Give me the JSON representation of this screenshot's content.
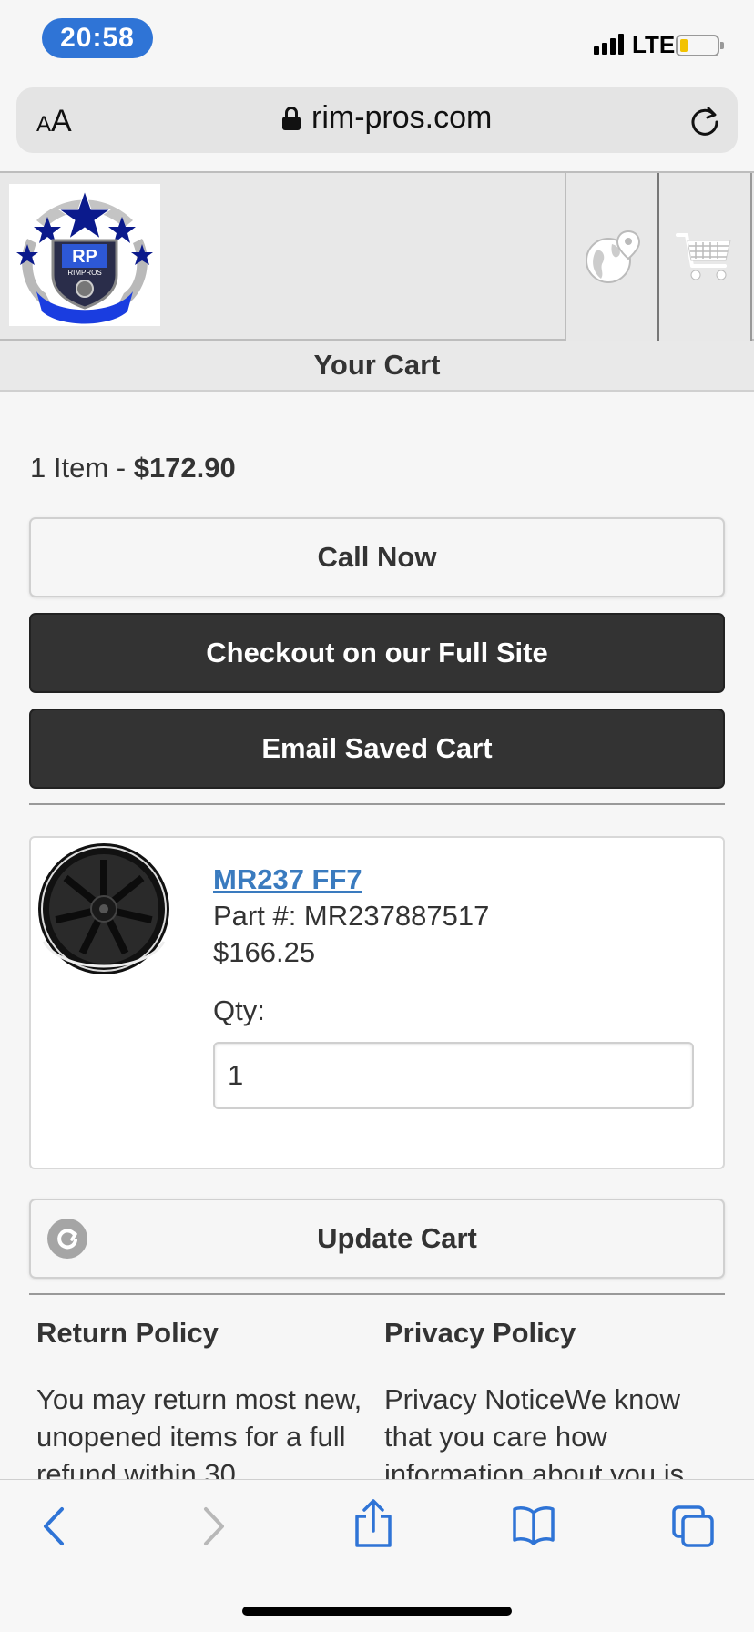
{
  "status_bar": {
    "time": "20:58",
    "network": "LTE"
  },
  "browser": {
    "text_size_label": "AA",
    "url": "rim-pros.com"
  },
  "header": {
    "logo_text": "RP",
    "logo_subtext": "RIMPROS"
  },
  "page": {
    "title": "Your Cart"
  },
  "cart": {
    "item_count": "1 Item - ",
    "total": "$172.90",
    "call_now": "Call Now",
    "checkout": "Checkout on our Full Site",
    "email_cart": "Email Saved Cart",
    "update_cart": "Update Cart",
    "items": [
      {
        "name": "MR237 FF7 ",
        "part": "Part #: MR237887517",
        "price": "$166.25",
        "qty_label": "Qty:",
        "qty_value": "1"
      }
    ]
  },
  "policies": {
    "return_title": "Return Policy",
    "return_text": "You may return most new, unopened items for a full refund within 30",
    "privacy_title": "Privacy Policy",
    "privacy_text": "Privacy NoticeWe know that you care how information about you is"
  }
}
